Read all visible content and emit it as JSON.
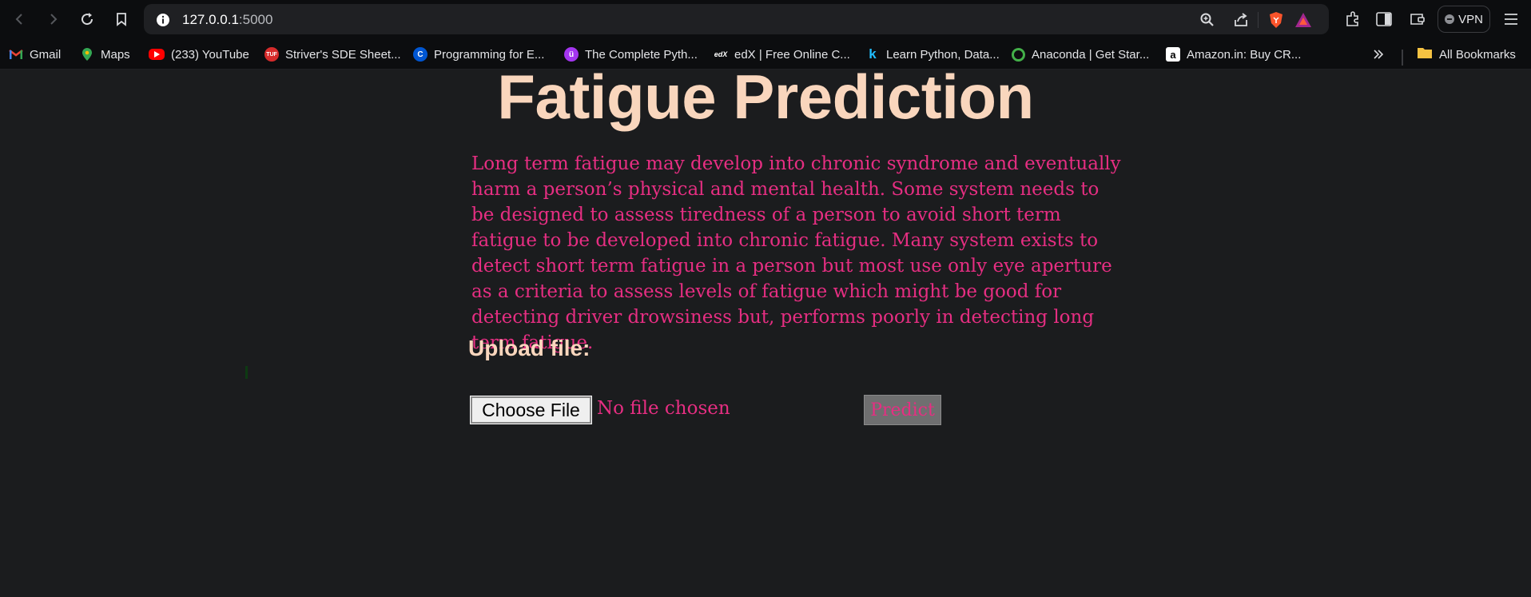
{
  "browser": {
    "url_host": "127.0.0.1",
    "url_port": ":5000",
    "vpn_label": "VPN"
  },
  "bookmarks": [
    {
      "label": "Gmail",
      "icon": "gmail-icon",
      "color": "#ea4335"
    },
    {
      "label": "Maps",
      "icon": "maps-icon",
      "color": "#34a853"
    },
    {
      "label": "(233) YouTube",
      "icon": "youtube-icon",
      "color": "#ff0000"
    },
    {
      "label": "Striver's SDE Sheet...",
      "icon": "tuf-icon",
      "color": "#d62b2b"
    },
    {
      "label": "Programming for E...",
      "icon": "coursera-icon",
      "color": "#0056d2"
    },
    {
      "label": "The Complete Pyth...",
      "icon": "udemy-icon",
      "color": "#a435f0"
    },
    {
      "label": "edX | Free Online C...",
      "icon": "edx-icon",
      "color": "#02262b"
    },
    {
      "label": "Learn Python, Data...",
      "icon": "kaggle-icon",
      "color": "#20beff"
    },
    {
      "label": "Anaconda | Get Star...",
      "icon": "anaconda-icon",
      "color": "#43b049"
    },
    {
      "label": "Amazon.in: Buy CR...",
      "icon": "amazon-icon",
      "color": "#ffffff"
    }
  ],
  "all_bookmarks_label": "All Bookmarks",
  "page": {
    "title": "Fatigue Prediction",
    "description": "Long term fatigue may develop into chronic syndrome and eventually harm a person’s physical and mental health. Some system needs to be designed to assess tiredness of a person to avoid short term fatigue to be developed into chronic fatigue. Many system exists to detect short term fatigue in a person but most use only eye aperture as a criteria to assess levels of fatigue which might be good for detecting driver drowsiness but, performs poorly in detecting long term fatigue.",
    "upload_label": "Upload file:",
    "choose_file_label": "Choose File",
    "file_status": "No file chosen",
    "predict_label": "Predict"
  },
  "colors": {
    "title": "#f9d6bd",
    "accent_text": "#e62e82",
    "background": "#1b1c1e"
  }
}
